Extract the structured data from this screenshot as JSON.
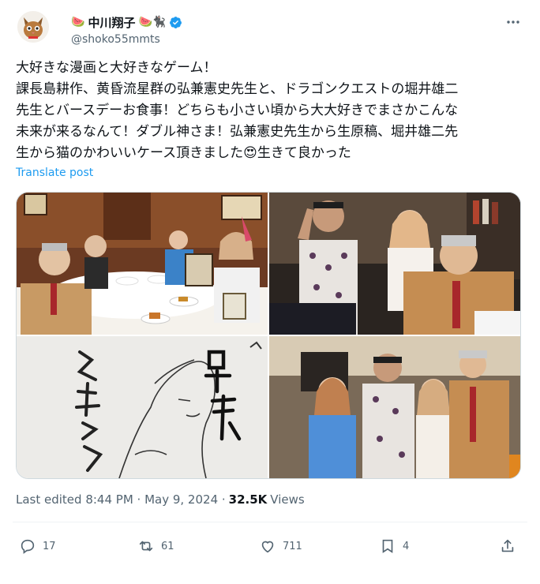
{
  "author": {
    "name": "中川翔子",
    "name_emoji_left": "🍉",
    "name_emoji_right": "🍉🐈‍⬛",
    "handle": "@shoko55mmts"
  },
  "post": {
    "line1": "大好きな漫画と大好きなゲーム！",
    "line2": "課長島耕作、黄昏流星群の弘兼憲史先生と、ドラゴンクエストの堀井雄二",
    "line3": "先生とバースデーお食事！どちらも小さい頃から大大好きでまさかこんな",
    "line4": "未来が来るなんて！ダブル神さま！弘兼憲史先生から生原稿、堀井雄二先",
    "line5a": "生から猫のかわいいケース頂きました",
    "line5_emoji": "😍",
    "line5b": "生きて良かった",
    "translate_label": "Translate post"
  },
  "photos": [
    {
      "label": "restaurant group photo"
    },
    {
      "label": "peace sign group photo"
    },
    {
      "label": "manga sketch with signature"
    },
    {
      "label": "standing group photo"
    }
  ],
  "meta": {
    "edited": "Last edited 8:44 PM · May 9, 2024 ·",
    "views_count": "32.5K",
    "views_label": "Views"
  },
  "actions": {
    "replies": "17",
    "reposts": "61",
    "likes": "711",
    "bookmarks": "4"
  }
}
